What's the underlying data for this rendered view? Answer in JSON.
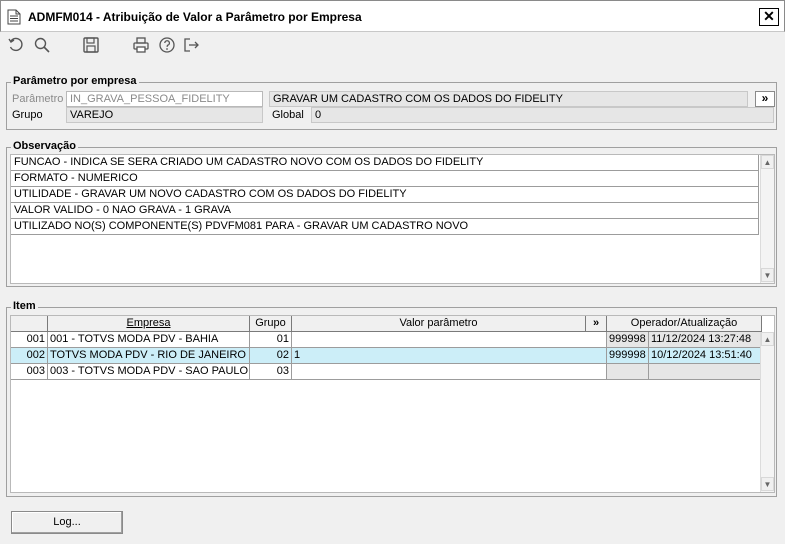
{
  "window": {
    "title": "ADMFM014 - Atribuição de Valor a Parâmetro por Empresa",
    "close_label": "✕"
  },
  "toolbar": {
    "icons": [
      "refresh-icon",
      "search-icon",
      "save-icon",
      "print-icon",
      "help-icon",
      "exit-icon"
    ]
  },
  "param_section": {
    "title": "Parâmetro por empresa",
    "parametro_label": "Parâmetro",
    "parametro_value": "IN_GRAVA_PESSOA_FIDELITY",
    "parametro_desc": "GRAVAR UM CADASTRO COM OS DADOS DO FIDELITY",
    "lookup_label": "»",
    "grupo_label": "Grupo",
    "grupo_value": "VAREJO",
    "global_label": "Global",
    "global_value": "0"
  },
  "obs_section": {
    "title": "Observação",
    "lines": [
      "FUNCAO - INDICA SE SERA CRIADO UM CADASTRO NOVO COM OS DADOS DO FIDELITY",
      "FORMATO - NUMERICO",
      "UTILIDADE - GRAVAR UM NOVO CADASTRO COM OS DADOS DO FIDELITY",
      "VALOR VALIDO - 0 NAO GRAVA - 1 GRAVA",
      "UTILIZADO NO(S) COMPONENTE(S) PDVFM081 PARA  - GRAVAR UM CADASTRO NOVO"
    ]
  },
  "item_section": {
    "title": "Item",
    "headers": {
      "empresa": "Empresa",
      "grupo": "Grupo",
      "valor": "Valor parâmetro",
      "expand": "»",
      "operador": "Operador/Atualização"
    },
    "rows": [
      {
        "num": "001",
        "empresa": "001 - TOTVS MODA PDV - BAHIA",
        "grupo": "01",
        "valor": "",
        "operador": "999998",
        "data": "11/12/2024 13:27:48"
      },
      {
        "num": "002",
        "empresa": "TOTVS MODA PDV - RIO DE JANEIRO - NO",
        "grupo": "02",
        "valor": "1",
        "operador": "999998",
        "data": "10/12/2024 13:51:40"
      },
      {
        "num": "003",
        "empresa": "003 - TOTVS MODA PDV - SAO PAULO",
        "grupo": "03",
        "valor": "",
        "operador": "",
        "data": ""
      }
    ]
  },
  "footer": {
    "log_label": "Log..."
  },
  "colors": {
    "selected_row": "#cceef8",
    "background": "#f0f0f0"
  }
}
